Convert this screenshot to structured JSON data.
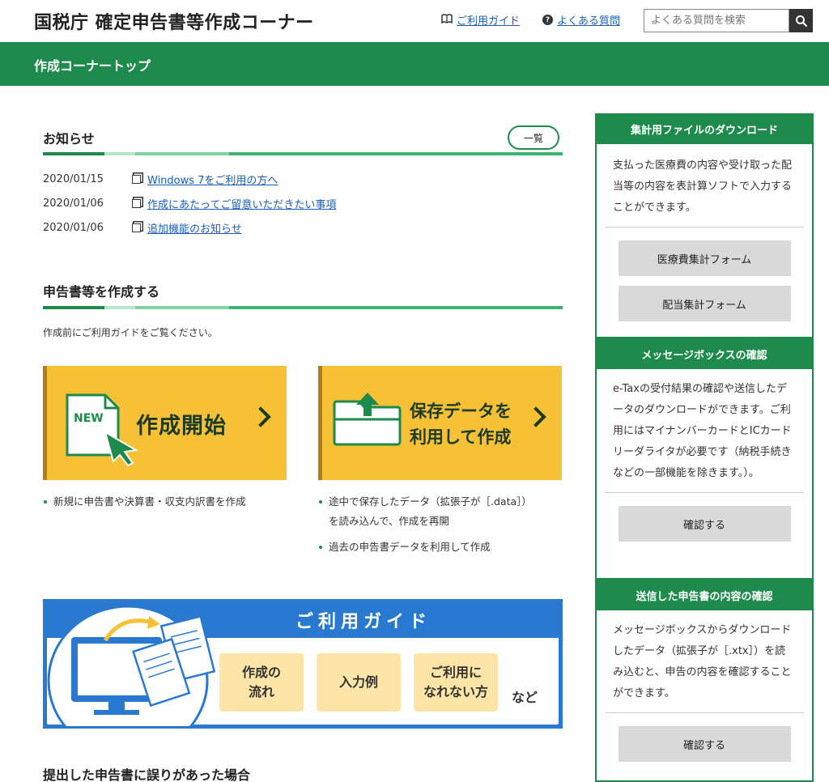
{
  "header": {
    "site_title": "国税庁 確定申告書等作成コーナー",
    "guide_link": "ご利用ガイド",
    "faq_link": "よくある質問",
    "search_placeholder": "よくある質問を検索"
  },
  "breadcrumb": {
    "label": "作成コーナートップ"
  },
  "news": {
    "title": "お知らせ",
    "list_button": "一覧",
    "items": [
      {
        "date": "2020/01/15",
        "text": "Windows 7をご利用の方へ"
      },
      {
        "date": "2020/01/06",
        "text": "作成にあたってご留意いただきたい事項"
      },
      {
        "date": "2020/01/06",
        "text": "追加機能のお知らせ"
      }
    ]
  },
  "create": {
    "title": "申告書等を作成する",
    "intro": "作成前にご利用ガイドをご覧ください。",
    "start_button": {
      "badge": "NEW",
      "label": "作成開始"
    },
    "saved_button": {
      "label_line1": "保存データを",
      "label_line2": "利用して作成"
    },
    "start_bullets": [
      "新規に申告書や決算書・収支内訳書を作成"
    ],
    "saved_bullets": [
      "途中で保存したデータ（拡張子が［.data］）",
      "を読み込んで、作成を再開",
      "過去の申告書データを利用して作成"
    ]
  },
  "guide_banner": {
    "title": "ご利用ガイド",
    "tiles": [
      {
        "line1": "作成の",
        "line2": "流れ"
      },
      {
        "line1": "入力例",
        "line2": ""
      },
      {
        "line1": "ご利用に",
        "line2": "なれない方"
      }
    ],
    "etc": "など"
  },
  "bottom": {
    "title": "提出した申告書に誤りがあった場合"
  },
  "sidebar": {
    "download": {
      "title": "集計用ファイルのダウンロード",
      "text": "支払った医療費の内容や受け取った配当等の内容を表計算ソフトで入力することができます。",
      "buttons": [
        "医療費集計フォーム",
        "配当集計フォーム"
      ]
    },
    "messagebox": {
      "title": "メッセージボックスの確認",
      "text": "e-Taxの受付結果の確認や送信したデータのダウンロードができます。ご利用にはマイナンバーカードとICカードリーダライタが必要です（納税手続きなどの一部機能を除きます。）。",
      "button": "確認する"
    },
    "sent": {
      "title": "送信した申告書の内容の確認",
      "text": "メッセージボックスからダウンロードしたデータ（拡張子が［.xtx］）を読み込むと、申告の内容を確認することができます。",
      "button": "確認する"
    }
  },
  "colors": {
    "green": "#1e8a4c",
    "yellow": "#f7c137",
    "blue": "#2a79d0"
  }
}
